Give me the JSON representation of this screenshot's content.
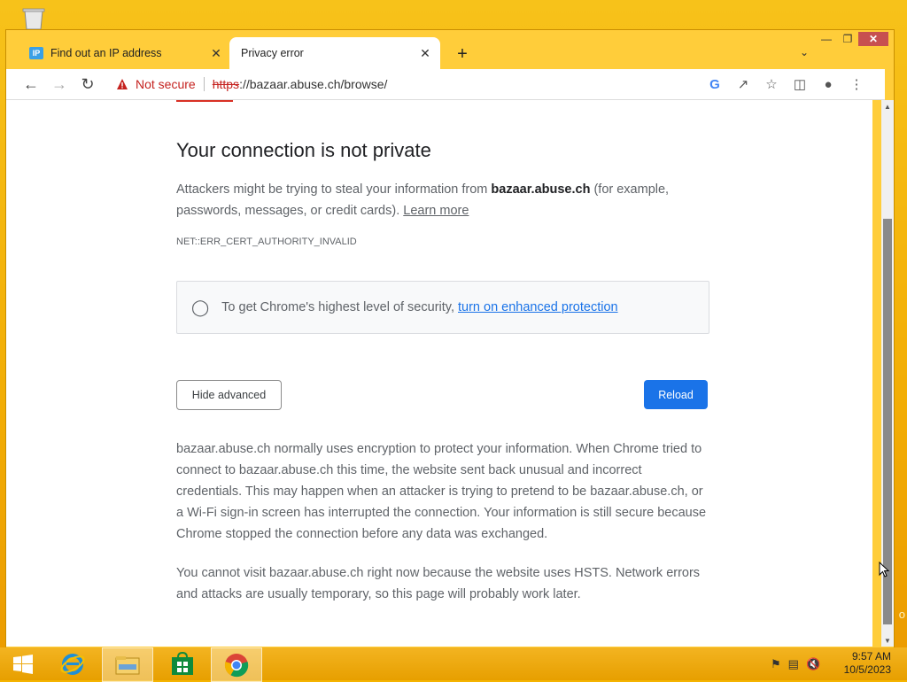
{
  "browser": {
    "tabs": [
      {
        "favicon": "IP",
        "title": "Find out an IP address",
        "active": false
      },
      {
        "title": "Privacy error",
        "active": true
      }
    ],
    "new_tab": "+",
    "tab_search": "⌄",
    "address": {
      "security_label": "Not secure",
      "url_scheme": "https",
      "url_rest": "://bazaar.abuse.ch/browse/"
    },
    "icons": [
      "back-icon",
      "forward-icon",
      "reload-icon",
      "warning-icon",
      "google-icon",
      "share-icon",
      "star-icon",
      "side-panel-icon",
      "profile-icon",
      "menu-icon"
    ]
  },
  "page": {
    "heading": "Your connection is not private",
    "intro_before": "Attackers might be trying to steal your information from ",
    "intro_host": "bazaar.abuse.ch",
    "intro_after": " (for example, passwords, messages, or credit cards). ",
    "learn_more": "Learn more",
    "error_code": "NET::ERR_CERT_AUTHORITY_INVALID",
    "tip_text": "To get Chrome's highest level of security, ",
    "tip_link": "turn on enhanced protection",
    "hide_advanced": "Hide advanced",
    "reload": "Reload",
    "para1": "bazaar.abuse.ch normally uses encryption to protect your information. When Chrome tried to connect to bazaar.abuse.ch this time, the website sent back unusual and incorrect credentials. This may happen when an attacker is trying to pretend to be bazaar.abuse.ch, or a Wi-Fi sign-in screen has interrupted the connection. Your information is still secure because Chrome stopped the connection before any data was exchanged.",
    "para2": "You cannot visit bazaar.abuse.ch right now because the website uses HSTS. Network errors and attacks are usually temporary, so this page will probably work later."
  },
  "taskbar": {
    "clock_time": "9:57 AM",
    "clock_date": "10/5/2023"
  },
  "colors": {
    "accent": "#1a73e8",
    "danger": "#c5221f",
    "desktop": "#f2ad05"
  }
}
